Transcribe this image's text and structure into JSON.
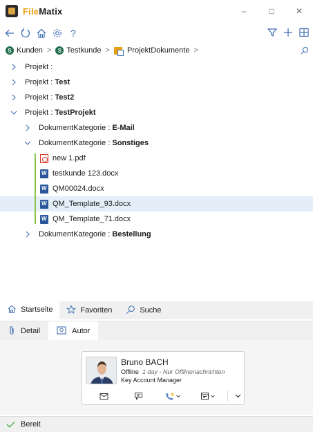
{
  "window": {
    "title_prefix": "File",
    "title_suffix": "Matix",
    "minimize": "–",
    "maximize": "□",
    "close": "✕"
  },
  "toolbar": {
    "left_icons": [
      "back-arrow-icon",
      "refresh-icon",
      "home-icon",
      "settings-gear-icon",
      "help-icon"
    ],
    "help_label": "?",
    "right_icons": [
      "filter-icon",
      "add-icon",
      "grid-icon"
    ]
  },
  "breadcrumb": {
    "items": [
      {
        "label": "Kunden",
        "icon": "sharepoint-site-icon",
        "badge": "S"
      },
      {
        "label": "Testkunde",
        "icon": "sharepoint-site-icon",
        "badge": "S"
      },
      {
        "label": "ProjektDokumente",
        "icon": "document-library-icon"
      }
    ],
    "separator": ">"
  },
  "tree": {
    "rows": [
      {
        "prefix": "Projekt : ",
        "value": "",
        "expanded": false
      },
      {
        "prefix": "Projekt : ",
        "value": "Test",
        "expanded": false
      },
      {
        "prefix": "Projekt : ",
        "value": "Test2",
        "expanded": false
      },
      {
        "prefix": "Projekt : ",
        "value": "TestProjekt",
        "expanded": true
      },
      {
        "prefix": "DokumentKategorie : ",
        "value": "E-Mail",
        "expanded": false
      },
      {
        "prefix": "DokumentKategorie : ",
        "value": "Sonstiges",
        "expanded": true
      },
      {
        "file": "new 1.pdf",
        "type": "pdf"
      },
      {
        "file": "testkunde 123.docx",
        "type": "word"
      },
      {
        "file": "QM00024.docx",
        "type": "word"
      },
      {
        "file": "QM_Template_93.docx",
        "type": "word",
        "selected": true
      },
      {
        "file": "QM_Template_71.docx",
        "type": "word"
      },
      {
        "prefix": "DokumentKategorie : ",
        "value": "Bestellung",
        "expanded": false
      }
    ]
  },
  "navtabs": [
    {
      "label": "Startseite",
      "icon": "home-icon",
      "active": true
    },
    {
      "label": "Favoriten",
      "icon": "star-icon",
      "active": false
    },
    {
      "label": "Suche",
      "icon": "search-icon",
      "active": false
    }
  ],
  "detailtabs": [
    {
      "label": "Detail",
      "icon": "paperclip-icon",
      "active": false
    },
    {
      "label": "Autor",
      "icon": "contact-card-icon",
      "active": true
    }
  ],
  "contact": {
    "name": "Bruno BACH",
    "status": "Offline",
    "status_detail": "1 day - Nur Offlinenachrichten",
    "role": "Key Account Manager",
    "actions": [
      "mail-icon",
      "chat-icon",
      "phone-icon",
      "calendar-icon",
      "more-chevron-icon"
    ]
  },
  "statusbar": {
    "text": "Bereit"
  },
  "colors": {
    "accent_blue": "#3f6fb5",
    "brand_orange": "#e8a013",
    "selection": "#e3eef9",
    "guide_green": "#8bc34a"
  }
}
